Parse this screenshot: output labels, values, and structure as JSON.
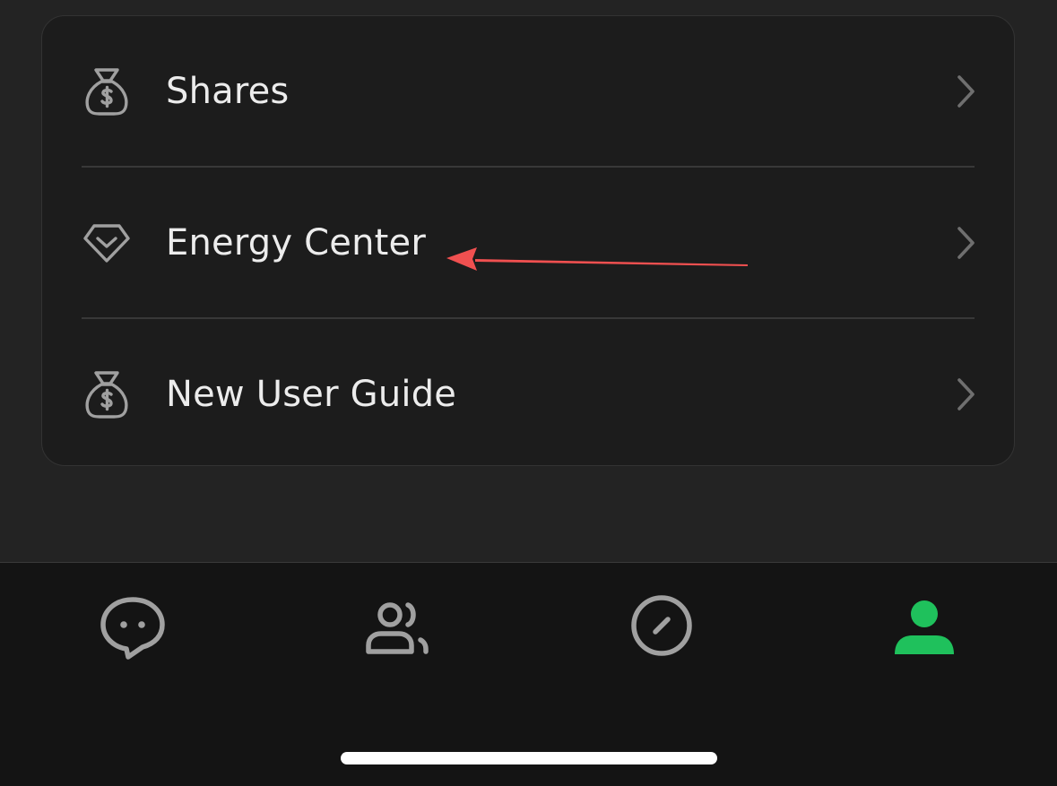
{
  "menu": {
    "items": [
      {
        "label": "Shares",
        "icon": "money-bag-icon"
      },
      {
        "label": "Energy Center",
        "icon": "diamond-heart-icon"
      },
      {
        "label": "New User Guide",
        "icon": "money-bag-icon"
      }
    ]
  },
  "tabbar": {
    "tabs": [
      {
        "name": "chats",
        "icon": "chat-bubble-icon",
        "active": false
      },
      {
        "name": "contacts",
        "icon": "contacts-icon",
        "active": false
      },
      {
        "name": "discover",
        "icon": "compass-icon",
        "active": false
      },
      {
        "name": "me",
        "icon": "person-icon",
        "active": true
      }
    ]
  },
  "colors": {
    "background": "#232323",
    "card": "#1c1c1c",
    "text": "#ececec",
    "icon": "#a0a0a0",
    "active_tab": "#1fc15c",
    "annotation_arrow": "#f05050",
    "tabbar": "#141414"
  }
}
